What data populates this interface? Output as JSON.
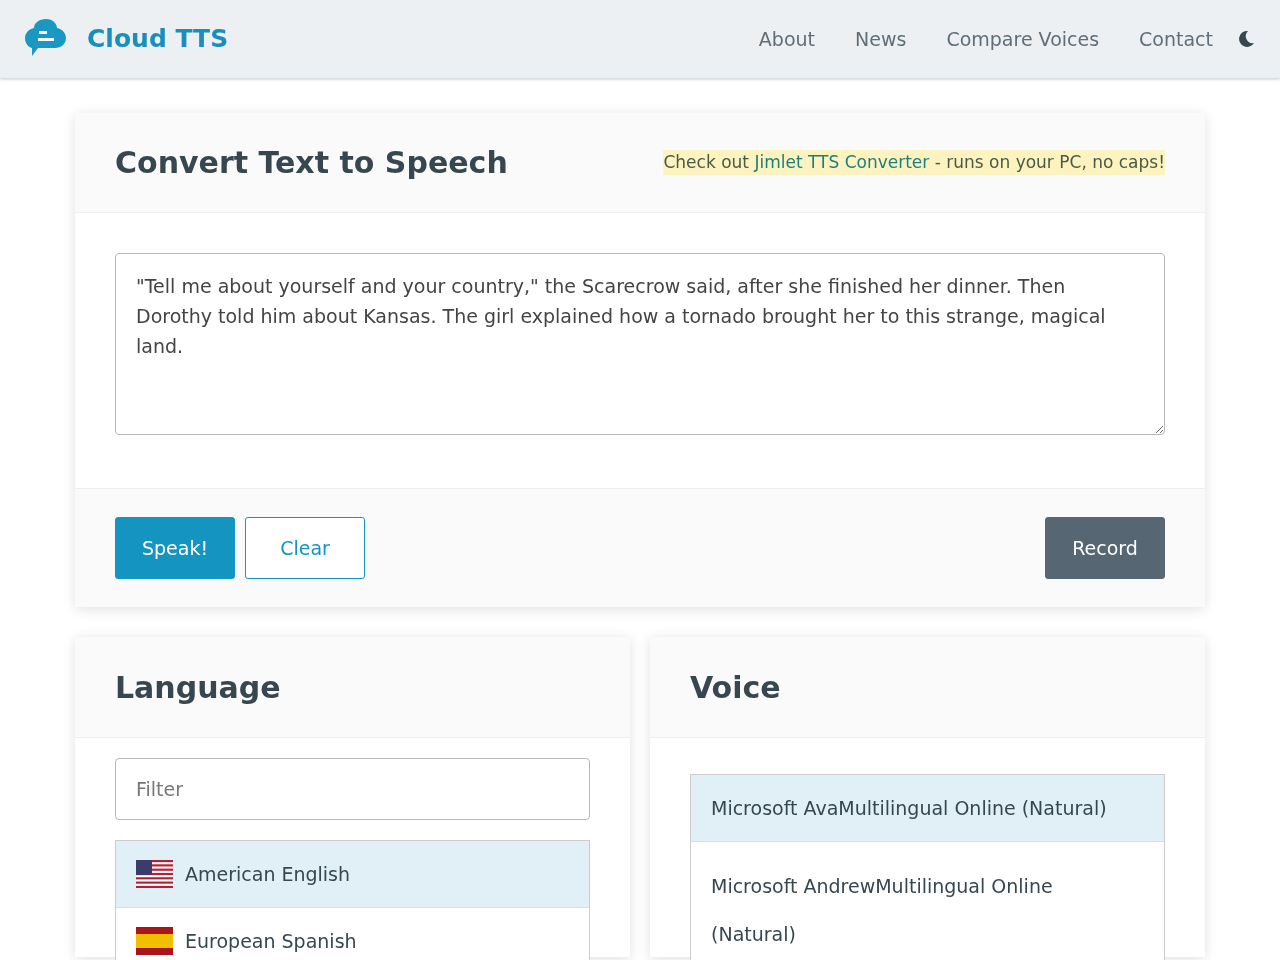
{
  "header": {
    "brand": "Cloud TTS",
    "nav": [
      {
        "label": "About"
      },
      {
        "label": "News"
      },
      {
        "label": "Compare Voices"
      },
      {
        "label": "Contact"
      }
    ]
  },
  "converter": {
    "title": "Convert Text to Speech",
    "promo": {
      "before": "Check out",
      "link": "Jimlet TTS Converter",
      "after": "- runs on your PC, no caps!"
    },
    "text": "\"Tell me about yourself and your country,\" the Scarecrow said, after she finished her dinner. Then Dorothy told him about Kansas. The girl explained how a tornado brought her to this strange, magical land.",
    "buttons": [
      {
        "label": "Speak!",
        "kind": "primary"
      },
      {
        "label": "Clear",
        "kind": "outline"
      },
      {
        "label": "Record",
        "kind": "secondary"
      }
    ]
  },
  "language": {
    "title": "Language",
    "filter": {
      "placeholder": "Filter"
    },
    "items": [
      {
        "label": "American English",
        "kind": "us",
        "selected": true
      },
      {
        "label": "European Spanish",
        "kind": "es",
        "selected": false
      }
    ]
  },
  "voice": {
    "title": "Voice",
    "items": [
      {
        "label": "Microsoft AvaMultilingual Online (Natural)",
        "selected": true
      },
      {
        "label": "Microsoft AndrewMultilingual Online (Natural)",
        "selected": false
      }
    ]
  }
}
